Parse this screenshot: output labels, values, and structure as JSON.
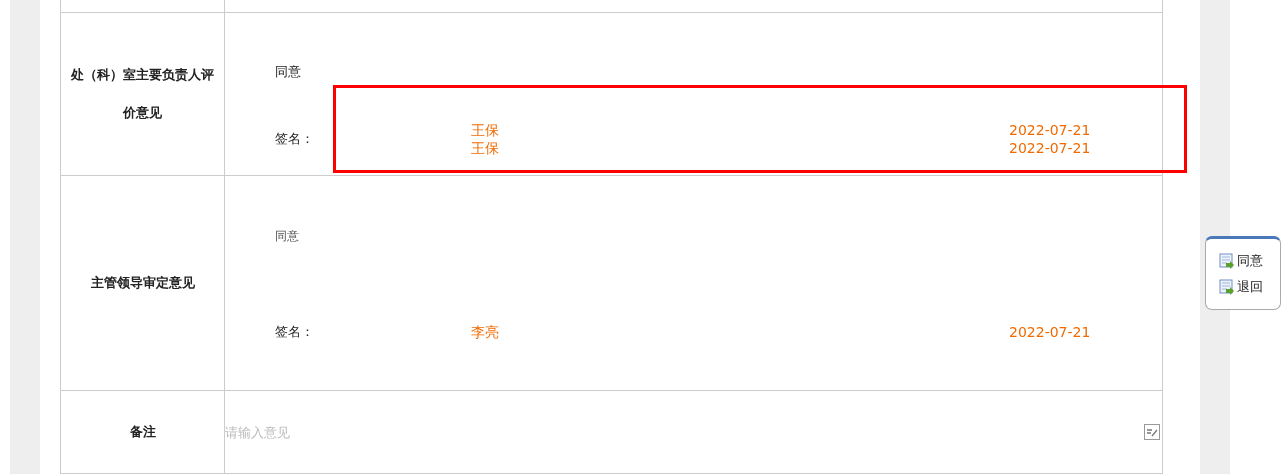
{
  "rows": [
    {
      "kind": "opinion",
      "label": "处（科）室主要负责人评价意见",
      "opinion": "同意",
      "sign_label": "签名：",
      "signatures": [
        {
          "name": "王保",
          "date": "2022-07-21"
        },
        {
          "name": "王保",
          "date": "2022-07-21"
        }
      ],
      "highlighted": true
    },
    {
      "kind": "opinion",
      "label": "主管领导审定意见",
      "opinion": "同意",
      "sign_label": "签名：",
      "signatures": [
        {
          "name": "李亮",
          "date": "2022-07-21"
        }
      ],
      "highlighted": false
    },
    {
      "kind": "remark",
      "label": "备注",
      "placeholder": "请输入意见"
    }
  ],
  "actions": [
    {
      "label": "同意"
    },
    {
      "label": "退回"
    }
  ]
}
